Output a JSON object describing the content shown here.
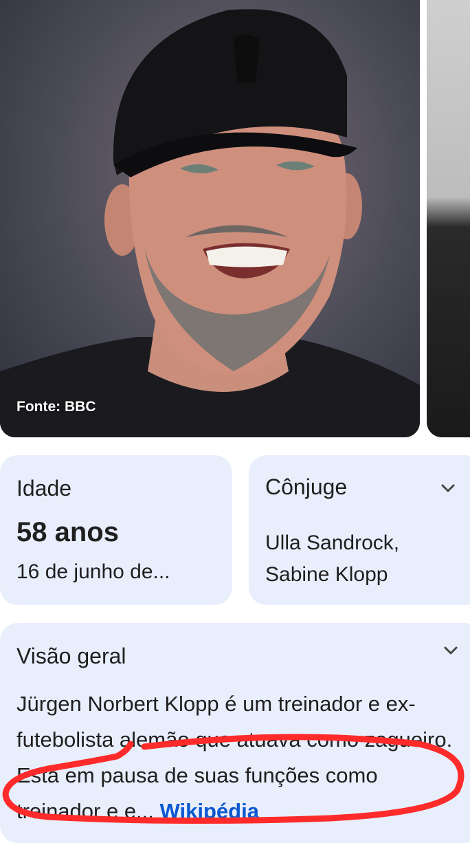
{
  "image_panel": {
    "source_label": "Fonte: BBC",
    "main_photo_alt": "Jürgen Klopp smiling in a black cap",
    "side_photo_alt": "partial second photo"
  },
  "cards": {
    "age": {
      "title": "Idade",
      "value": "58 anos",
      "detail": "16 de junho de..."
    },
    "spouse": {
      "title": "Cônjuge",
      "lines": [
        "Ulla Sandrock,",
        "Sabine Klopp"
      ]
    },
    "overview": {
      "title": "Visão geral",
      "text": "Jürgen Norbert Klopp é um treinador e ex-futebolista alemão que atuava como zagueiro. Está em pausa de suas funções como treinador e e... ",
      "link_label": "Wikipédia"
    }
  },
  "colors": {
    "card_background": "#e8eefb",
    "link": "#0b57d0",
    "annotation": "#ff2b2b"
  },
  "icons": [
    "chevron-down-icon"
  ]
}
